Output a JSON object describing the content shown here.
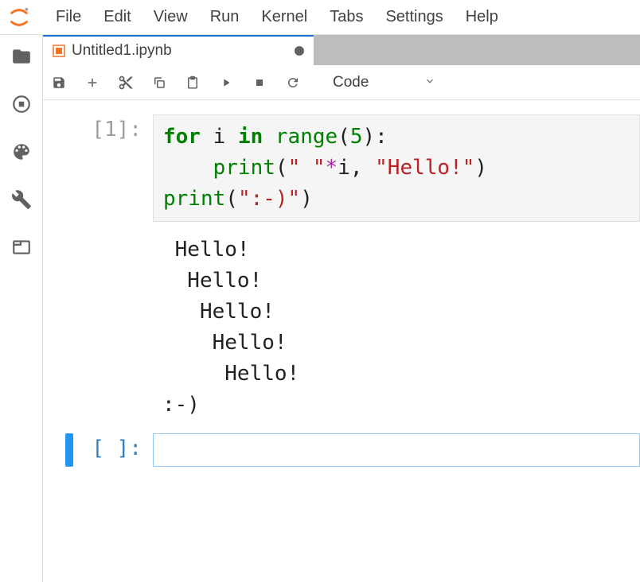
{
  "menu": [
    "File",
    "Edit",
    "View",
    "Run",
    "Kernel",
    "Tabs",
    "Settings",
    "Help"
  ],
  "tab": {
    "title": "Untitled1.ipynb",
    "dirty": true
  },
  "celltype": "Code",
  "cells": [
    {
      "prompt": "[1]:",
      "code_tokens": [
        {
          "t": "for",
          "c": "kw"
        },
        {
          "t": " "
        },
        {
          "t": "i"
        },
        {
          "t": " "
        },
        {
          "t": "in",
          "c": "kw"
        },
        {
          "t": " "
        },
        {
          "t": "range",
          "c": "builtin"
        },
        {
          "t": "("
        },
        {
          "t": "5",
          "c": "num"
        },
        {
          "t": ")"
        },
        {
          "t": ":"
        },
        {
          "t": "\n"
        },
        {
          "t": "    "
        },
        {
          "t": "print",
          "c": "builtin"
        },
        {
          "t": "("
        },
        {
          "t": "\" \"",
          "c": "str"
        },
        {
          "t": "*",
          "c": "op"
        },
        {
          "t": "i"
        },
        {
          "t": ", "
        },
        {
          "t": "\"Hello!\"",
          "c": "str"
        },
        {
          "t": ")"
        },
        {
          "t": "\n"
        },
        {
          "t": "print",
          "c": "builtin"
        },
        {
          "t": "("
        },
        {
          "t": "\":-)\"",
          "c": "str"
        },
        {
          "t": ")"
        }
      ],
      "output": " Hello!\n  Hello!\n   Hello!\n    Hello!\n     Hello!\n:-)"
    },
    {
      "prompt": "[ ]:",
      "active": true
    }
  ]
}
